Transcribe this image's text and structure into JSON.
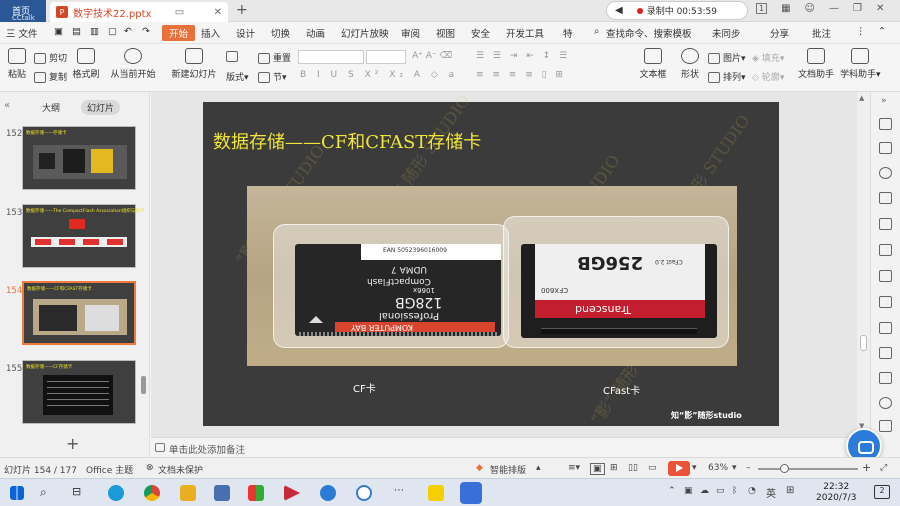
{
  "titlebar": {
    "home_label": "首页",
    "home_sub": "CCtalk",
    "doc_name": "数字技术22.pptx",
    "recording_label": "录制中 00:53:59",
    "page_indicator": "1"
  },
  "menu": {
    "file": "三 文件",
    "start": "开始",
    "items": [
      "插入",
      "设计",
      "切换",
      "动画",
      "幻灯片放映",
      "审阅",
      "视图",
      "安全",
      "开发工具",
      "特"
    ],
    "search_placeholder": "查找命令、搜索模板",
    "sync": "未同步",
    "share": "分享",
    "comment": "批注"
  },
  "toolbar": {
    "paste": "粘贴",
    "cut": "剪切",
    "copy": "复制",
    "format_painter": "格式刷",
    "play_from_current": "从当前开始",
    "new_slide": "新建幻灯片",
    "layout": "版式",
    "section": "节",
    "reset": "重置",
    "textbox": "文本框",
    "shape": "形状",
    "arrange": "排列",
    "picture": "图片",
    "fill": "填充",
    "outline": "轮廓",
    "doc_assistant": "文档助手",
    "subject_assistant": "学科助手"
  },
  "left_panel": {
    "tab_outline": "大纲",
    "tab_slides": "幻灯片",
    "thumbnails": [
      {
        "num": "152",
        "title": "数据存储——存储卡",
        "active": false
      },
      {
        "num": "153",
        "title": "数据存储——The CompactFlash Association组织与标卡",
        "active": false
      },
      {
        "num": "154",
        "title": "数据存储——CF和CFAST存储卡",
        "active": true
      },
      {
        "num": "155",
        "title": "数据存储——CF存储卡",
        "active": false
      }
    ]
  },
  "slide": {
    "title": "数据存储——CF和CFAST存储卡",
    "cf_card_text": [
      "KOMPUTER BAY",
      "Professional",
      "128GB",
      "1066x",
      "CompactFlash",
      "UDMA 7"
    ],
    "cfast_card_text": [
      "256GB",
      "CFast 2.0",
      "CFX600",
      "Transcend"
    ],
    "barcode_text": "EAN 5052396016009",
    "caption_cf": "CF卡",
    "caption_cfast": "CFast卡",
    "watermark_tag": "知“影”随形studio",
    "watermark": "“影” 随形 STUDIO"
  },
  "notes": {
    "placeholder": "单击此处添加备注"
  },
  "status": {
    "slide_counter": "幻灯片 154 / 177",
    "theme": "Office 主题",
    "doc_unprotected": "文档未保护",
    "smart_layout": "智能排版",
    "zoom": "63%"
  },
  "taskbar": {
    "lang": "英",
    "time": "22:32",
    "date": "2020/7/3",
    "notifications": "2"
  }
}
